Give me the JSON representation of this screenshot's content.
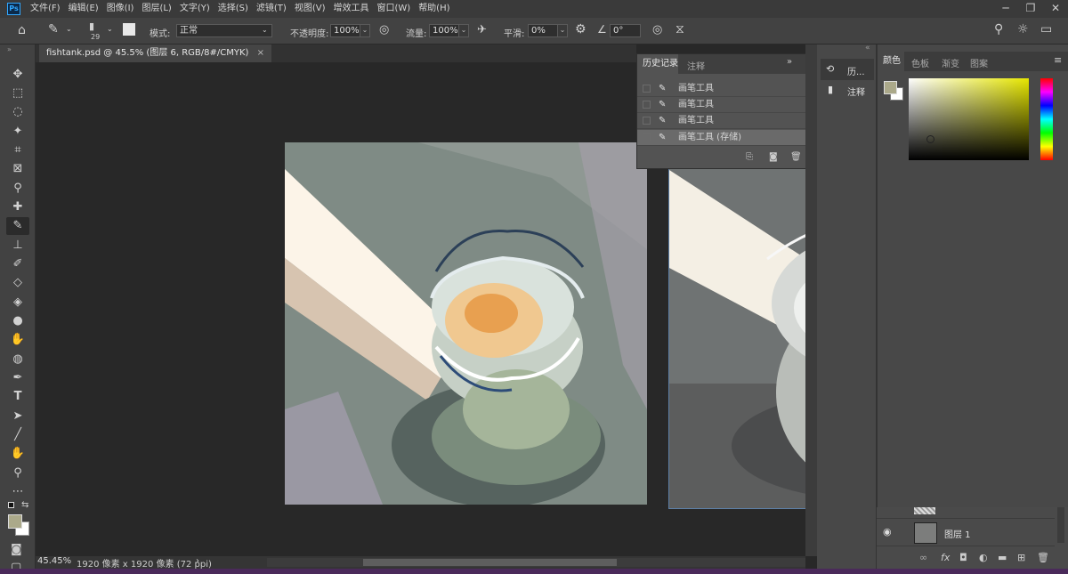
{
  "menubar": {
    "app_icon": "Ps",
    "items": [
      "文件(F)",
      "编辑(E)",
      "图像(I)",
      "图层(L)",
      "文字(Y)",
      "选择(S)",
      "滤镜(T)",
      "视图(V)",
      "增效工具",
      "窗口(W)",
      "帮助(H)"
    ]
  },
  "options": {
    "brush_size": "29",
    "mode_label": "模式:",
    "mode_value": "正常",
    "opacity_label": "不透明度:",
    "opacity_value": "100%",
    "flow_label": "流量:",
    "flow_value": "100%",
    "smoothing_label": "平滑:",
    "smoothing_value": "0%",
    "angle_value": "0°"
  },
  "document": {
    "tab_title": "fishtank.psd @ 45.5% (图层 6, RGB/8#/CMYK)",
    "close": "×"
  },
  "status": {
    "zoom": "45.45%",
    "info": "1920 像素 x 1920 像素 (72 ppi)",
    "arrow": "›"
  },
  "history": {
    "tabs": [
      "历史记录",
      "注释"
    ],
    "items": [
      "画笔工具",
      "画笔工具",
      "画笔工具",
      "画笔工具 (存储)"
    ]
  },
  "dock": {
    "history_short": "历...",
    "notes": "注释"
  },
  "color_panel": {
    "tabs": [
      "颜色",
      "色板",
      "渐变",
      "图案"
    ],
    "foreground": "#aba98a",
    "background": "#ffffff",
    "hue": "#e6e600"
  },
  "layers": {
    "layer_name": "图层 1"
  }
}
